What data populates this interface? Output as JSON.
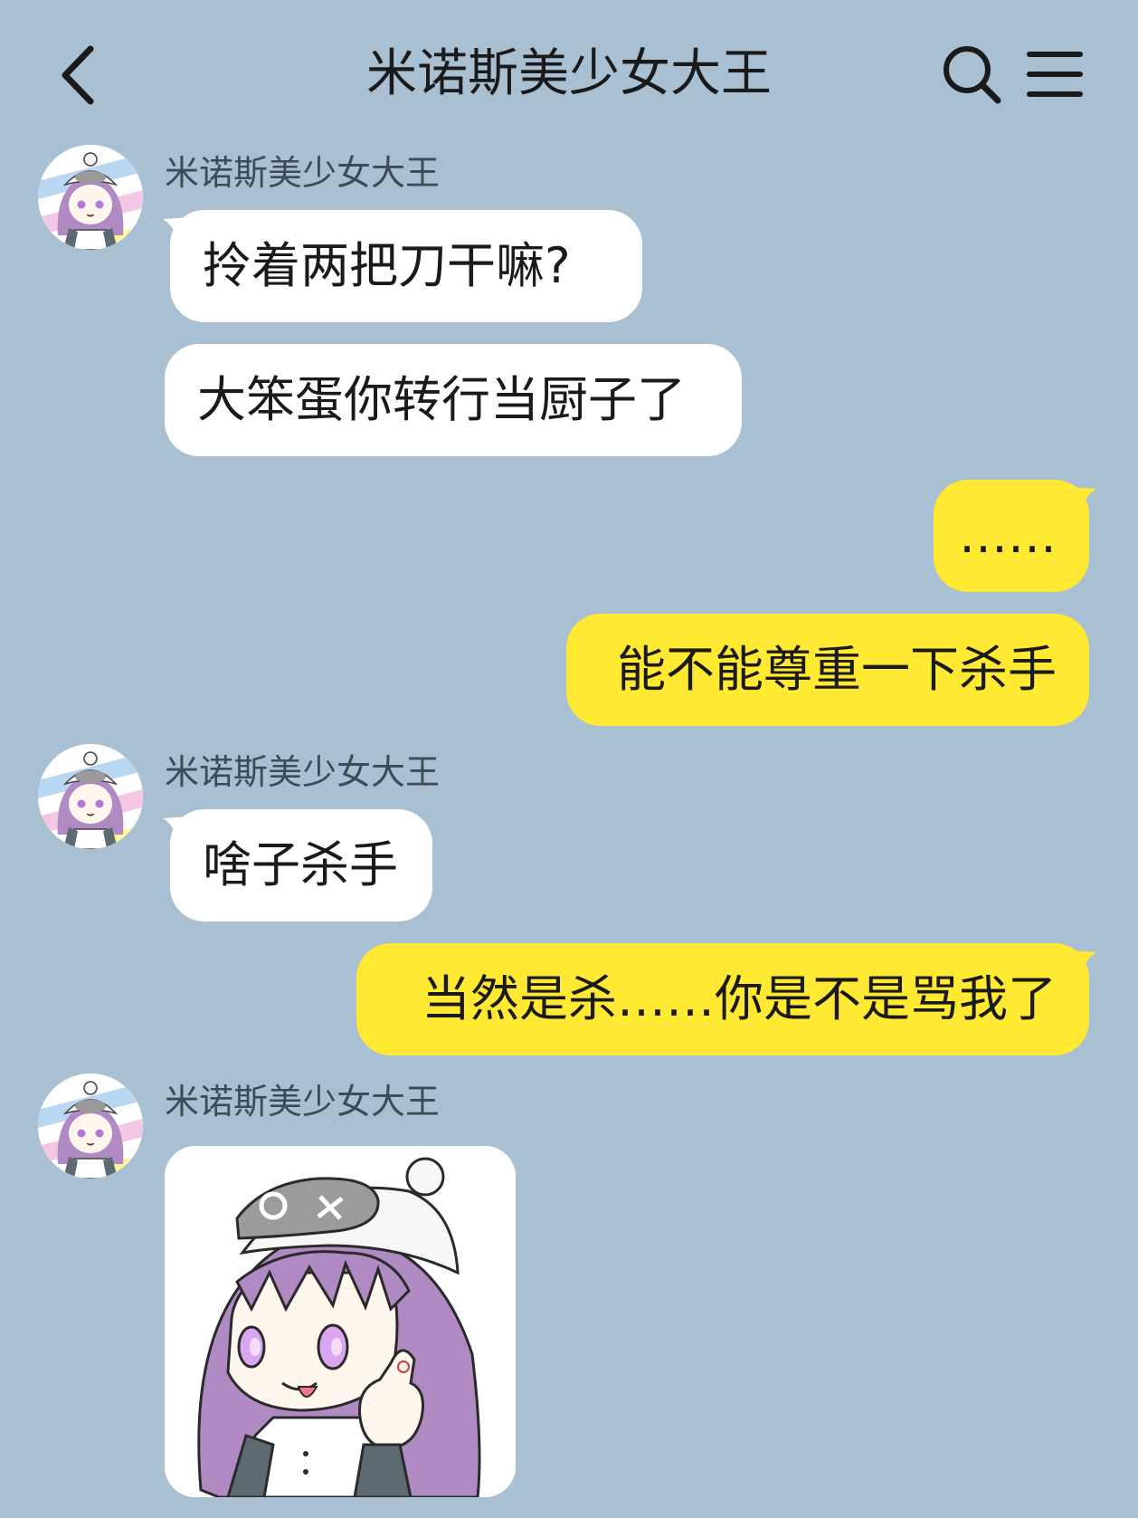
{
  "header": {
    "title": "米诺斯美少女大王",
    "back_icon": "chevron-left-icon",
    "search_icon": "search-icon",
    "menu_icon": "hamburger-menu-icon"
  },
  "colors": {
    "background": "#a9bfd2",
    "incoming_bubble": "#ffffff",
    "outgoing_bubble": "#ffe932"
  },
  "messages": [
    {
      "direction": "incoming",
      "sender": "米诺斯美少女大王",
      "text": "拎着两把刀干嘛?"
    },
    {
      "direction": "incoming",
      "text": "大笨蛋你转行当厨子了"
    },
    {
      "direction": "outgoing",
      "text": "……"
    },
    {
      "direction": "outgoing",
      "text": "能不能尊重一下杀手"
    },
    {
      "direction": "incoming",
      "sender": "米诺斯美少女大王",
      "text": "啥子杀手"
    },
    {
      "direction": "outgoing",
      "text": "当然是杀……你是不是骂我了"
    },
    {
      "direction": "incoming",
      "sender": "米诺斯美少女大王",
      "type": "sticker",
      "sticker": "thumbs-up-girl-sticker"
    }
  ]
}
